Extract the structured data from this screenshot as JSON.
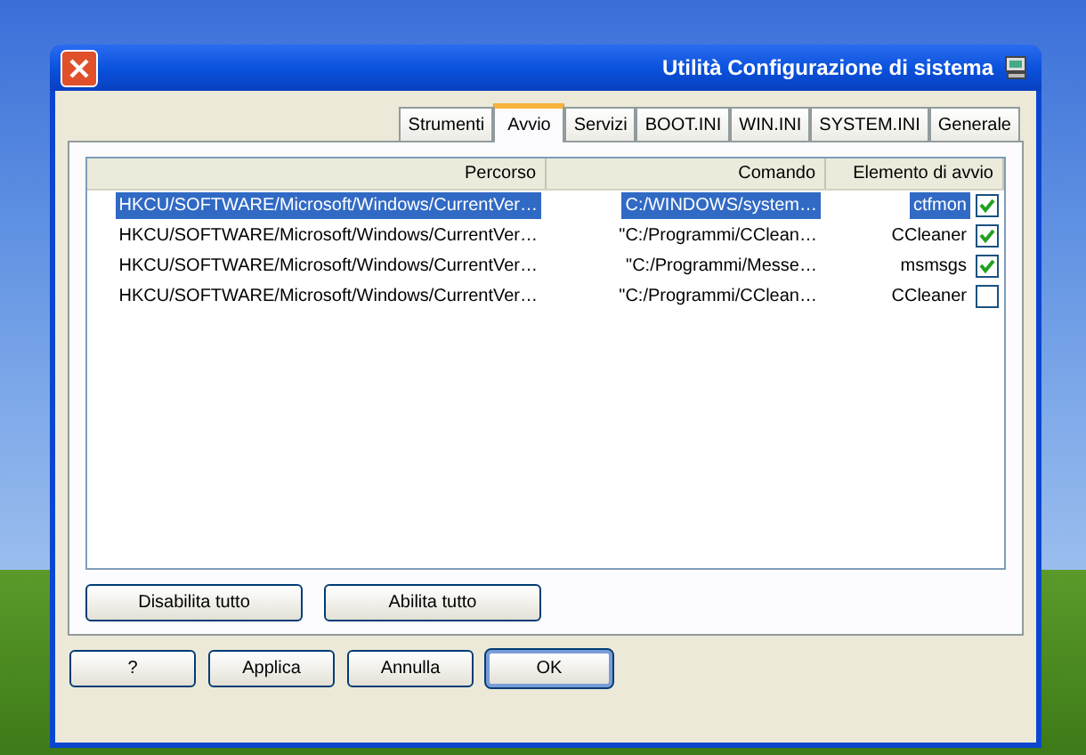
{
  "window": {
    "title": "Utilità Configurazione di sistema"
  },
  "tabs": [
    {
      "label": "Strumenti",
      "selected": false
    },
    {
      "label": "Avvio",
      "selected": true
    },
    {
      "label": "Servizi",
      "selected": false
    },
    {
      "label": "BOOT.INI",
      "selected": false
    },
    {
      "label": "WIN.INI",
      "selected": false
    },
    {
      "label": "SYSTEM.INI",
      "selected": false
    },
    {
      "label": "Generale",
      "selected": false
    }
  ],
  "table": {
    "columns": [
      "Percorso",
      "Comando",
      "Elemento di avvio"
    ],
    "rows": [
      {
        "checked": true,
        "selected": true,
        "cells": [
          "HKCU/SOFTWARE/Microsoft/Windows/CurrentVer…",
          "C:/WINDOWS/system…",
          "ctfmon"
        ]
      },
      {
        "checked": true,
        "selected": false,
        "cells": [
          "HKCU/SOFTWARE/Microsoft/Windows/CurrentVer…",
          "\"C:/Programmi/CClean…",
          "CCleaner"
        ]
      },
      {
        "checked": true,
        "selected": false,
        "cells": [
          "HKCU/SOFTWARE/Microsoft/Windows/CurrentVer…",
          "\"C:/Programmi/Messe…",
          "msmsgs"
        ]
      },
      {
        "checked": false,
        "selected": false,
        "cells": [
          "HKCU/SOFTWARE/Microsoft/Windows/CurrentVer…",
          "\"C:/Programmi/CClean…",
          "CCleaner"
        ]
      }
    ]
  },
  "panel_buttons": [
    "Disabilita tutto",
    "Abilita tutto"
  ],
  "dialog_buttons": [
    {
      "label": "?",
      "default": false
    },
    {
      "label": "Applica",
      "default": false
    },
    {
      "label": "Annulla",
      "default": false
    },
    {
      "label": "OK",
      "default": true
    }
  ]
}
